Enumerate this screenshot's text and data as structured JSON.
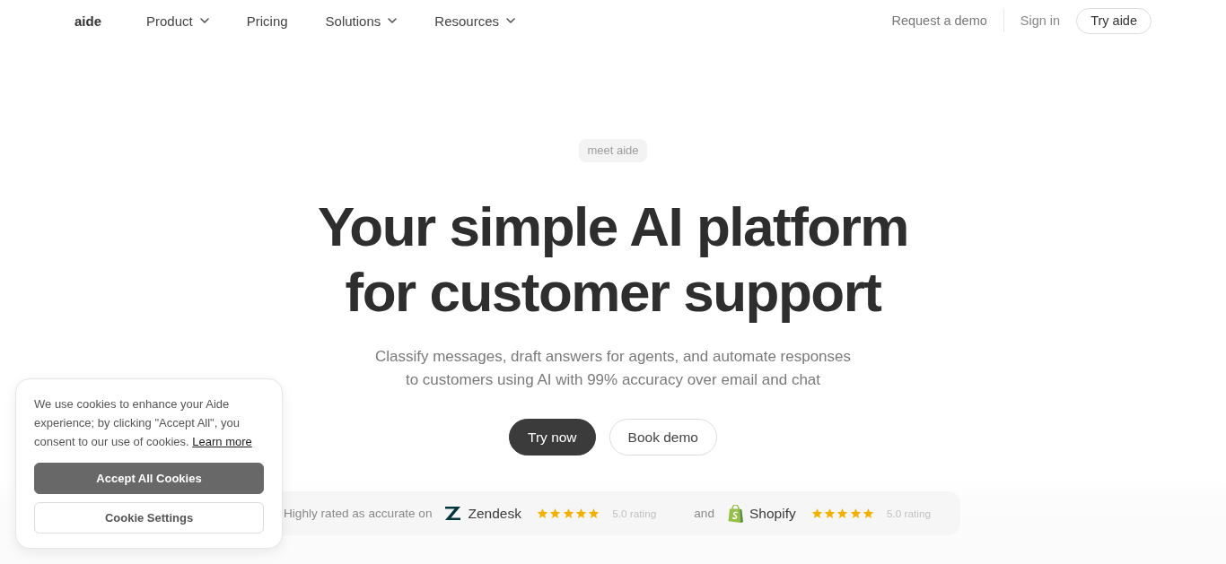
{
  "nav": {
    "logo": "aide",
    "links": [
      {
        "label": "Product",
        "dropdown": true
      },
      {
        "label": "Pricing",
        "dropdown": false
      },
      {
        "label": "Solutions",
        "dropdown": true
      },
      {
        "label": "Resources",
        "dropdown": true
      }
    ],
    "request_demo": "Request a demo",
    "sign_in": "Sign in",
    "cta": "Try aide"
  },
  "hero": {
    "badge": "meet aide",
    "title": "Your simple AI platform for customer support",
    "subtitle": "Classify messages, draft answers for agents, and automate responses to customers using AI with 99% accuracy over email and chat",
    "buttons": [
      {
        "label": "Try now",
        "kind": "primary"
      },
      {
        "label": "Book demo",
        "kind": "secondary"
      }
    ]
  },
  "ratings": {
    "lead": "Highly rated as accurate on",
    "joiner": "and",
    "platforms": [
      {
        "kind": "zendesk",
        "name": "Zendesk",
        "stars": 5,
        "rating": "5.0 rating"
      },
      {
        "kind": "shopify",
        "name": "Shopify",
        "stars": 5,
        "rating": "5.0 rating"
      }
    ]
  },
  "cookie_banner": {
    "text": "We use cookies to enhance your Aide experience; by clicking \"Accept All\", you consent to our use of cookies.",
    "link": "Learn more",
    "buttons": [
      {
        "label": "Accept All Cookies",
        "kind": "primary"
      },
      {
        "label": "Cookie Settings",
        "kind": "secondary"
      }
    ]
  }
}
